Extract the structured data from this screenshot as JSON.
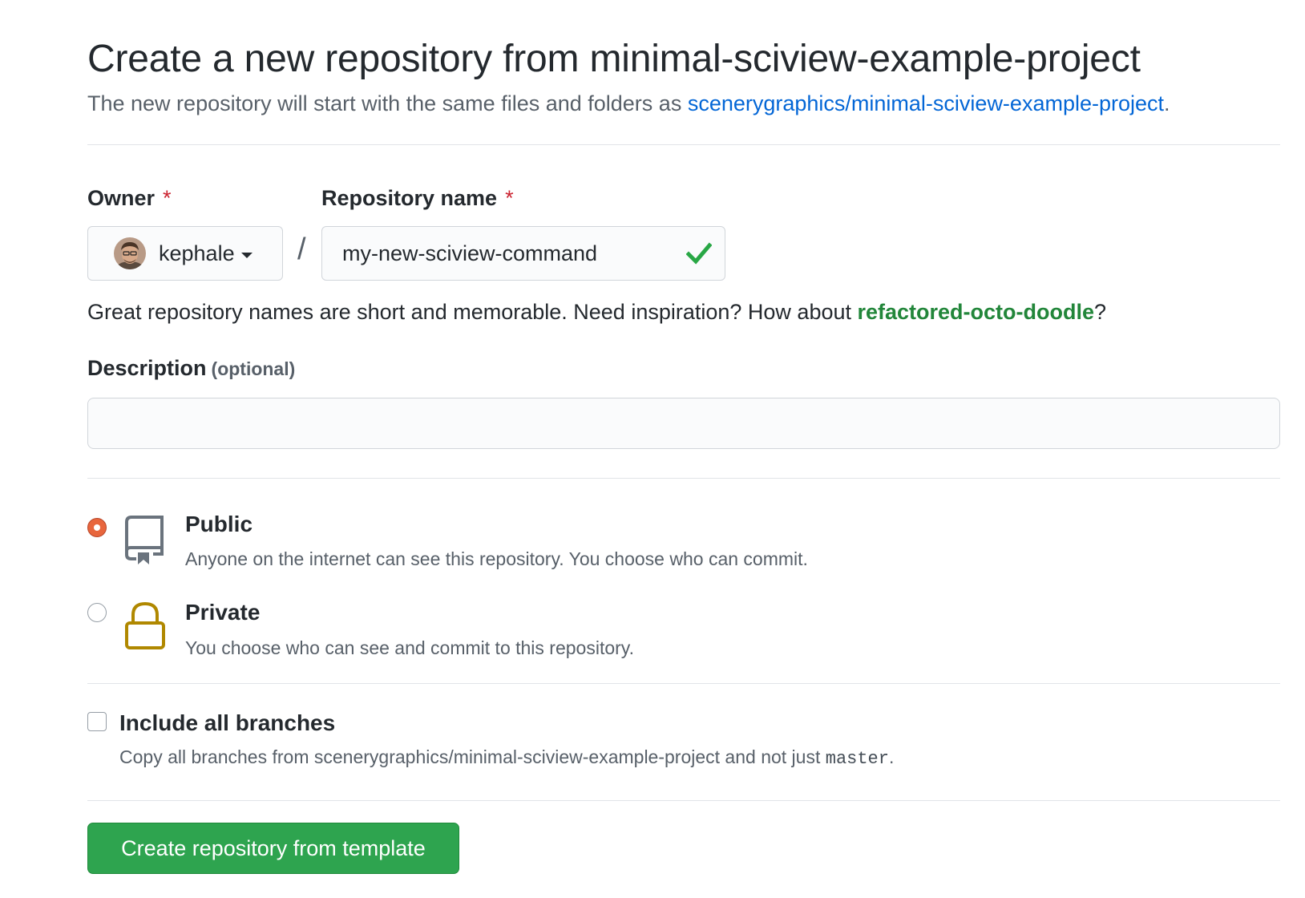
{
  "header": {
    "title": "Create a new repository from minimal-sciview-example-project",
    "subtitle_prefix": "The new repository will start with the same files and folders as ",
    "template_link": "scenerygraphics/minimal-sciview-example-project",
    "subtitle_suffix": "."
  },
  "owner": {
    "label": "Owner",
    "required_mark": "*",
    "value": "kephale"
  },
  "separator": "/",
  "repository": {
    "label": "Repository name",
    "required_mark": "*",
    "value": "my-new-sciview-command",
    "valid": true
  },
  "name_hint": {
    "prefix": "Great repository names are short and memorable. Need inspiration? How about ",
    "suggestion": "refactored-octo-doodle",
    "suffix": "?"
  },
  "description": {
    "label": "Description",
    "optional": "(optional)",
    "value": ""
  },
  "visibility": {
    "selected": "public",
    "options": [
      {
        "id": "public",
        "title": "Public",
        "note": "Anyone on the internet can see this repository. You choose who can commit.",
        "icon": "repo-icon"
      },
      {
        "id": "private",
        "title": "Private",
        "note": "You choose who can see and commit to this repository.",
        "icon": "lock-icon"
      }
    ]
  },
  "branches": {
    "title": "Include all branches",
    "note_prefix": "Copy all branches from scenerygraphics/minimal-sciview-example-project and not just ",
    "branch": "master",
    "note_suffix": ".",
    "checked": false
  },
  "submit": {
    "label": "Create repository from template"
  },
  "colors": {
    "link": "#0366d6",
    "success": "#22863a",
    "button": "#2ea44f",
    "required": "#cb2431",
    "radio_checked": "#e8663d",
    "lock": "#b08800"
  }
}
